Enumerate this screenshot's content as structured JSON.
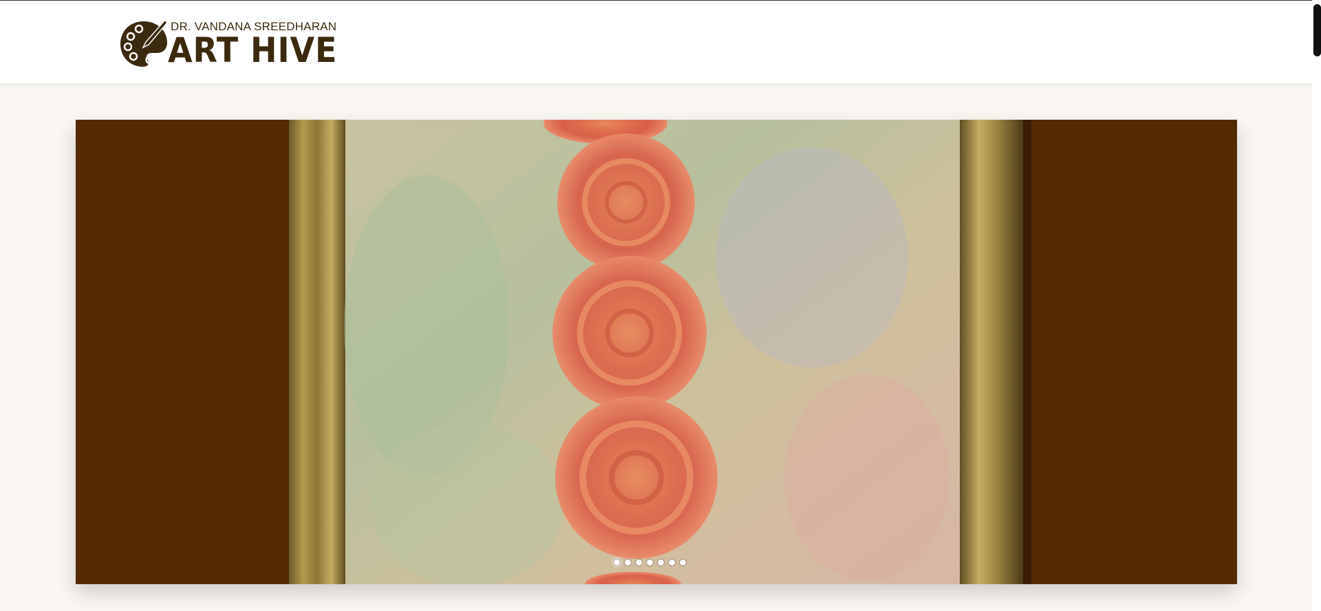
{
  "header": {
    "logo": {
      "subtitle": "DR. VANDANA SREEDHARAN",
      "title": "ART HIVE",
      "icon": "palette-icon"
    }
  },
  "slider": {
    "slide_count": 7,
    "active_index": 0,
    "background_color": "#542a02",
    "artwork": "framed painting of red spiral roses stacked vertically on pastel textured background"
  },
  "colors": {
    "brand": "#3c2a0f",
    "page_bg": "#faf7f3",
    "slider_bg": "#542a02"
  }
}
